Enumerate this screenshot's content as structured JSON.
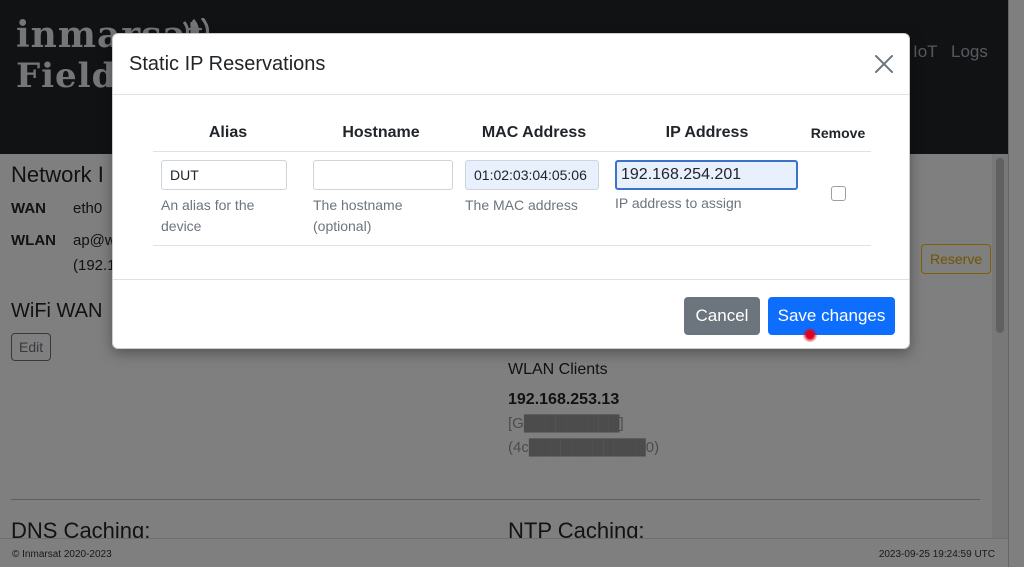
{
  "header": {
    "logo_line1": "inmarsat",
    "logo_line2": "FieldA",
    "nav": [
      "IoT",
      "Logs"
    ]
  },
  "page": {
    "network_title": "Network I",
    "wan_label": "WAN",
    "wan_value": "eth0",
    "wlan_label": "WLAN",
    "wlan_value_1": "ap@w",
    "wlan_value_2": "(192.1",
    "reserve_button": "Reserve",
    "wifi_wan_title": "WiFi WAN",
    "edit_button": "Edit",
    "wlan_clients_title": "WLAN Clients",
    "client_ip": "192.168.253.13",
    "client_name": "[G█████████]",
    "client_mac": "(4c███████████0)",
    "dns_title": "DNS Caching:",
    "ntp_title": "NTP Caching:"
  },
  "footer": {
    "copyright": "© Inmarsat 2020-2023",
    "timestamp": "2023-09-25 19:24:59 UTC"
  },
  "modal": {
    "title": "Static IP Reservations",
    "close_icon": "close-icon",
    "columns": {
      "alias": "Alias",
      "hostname": "Hostname",
      "mac": "MAC Address",
      "ip": "IP Address",
      "remove": "Remove"
    },
    "row": {
      "alias_value": "DUT",
      "alias_help": "An alias for the device",
      "hostname_value": "",
      "hostname_help": "The hostname (optional)",
      "mac_value": "01:02:03:04:05:06",
      "mac_help": "The MAC address",
      "ip_value": "192.168.254.201",
      "ip_help": "IP address to assign",
      "remove_checked": false
    },
    "cancel_button": "Cancel",
    "save_button": "Save changes"
  },
  "colors": {
    "primary": "#0d6efd",
    "secondary": "#6c757d",
    "warning": "#ffc107",
    "header_bg": "#212529"
  }
}
